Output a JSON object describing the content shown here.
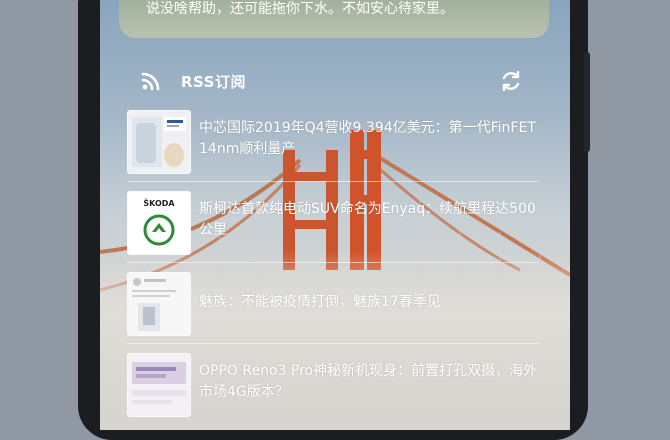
{
  "top_card": {
    "text": "说没啥帮助，还可能拖你下水。不如安心待家里。"
  },
  "rss": {
    "title": "RSS订阅",
    "icon": "rss-icon",
    "refresh_icon": "refresh-icon"
  },
  "feed": [
    {
      "title": "中芯国际2019年Q4营收9.394亿美元：第一代FinFET 14nm顺利量产"
    },
    {
      "title": "斯柯达首款纯电动SUV命名为Enyaq：续航里程达500公里",
      "thumb_logo": "ŠKODA"
    },
    {
      "title": "魅族：不能被疫情打倒，魅族17春季见"
    },
    {
      "title": "OPPO Reno3 Pro神秘新机现身：前置打孔双摄，海外市场4G版本？"
    }
  ],
  "colors": {
    "text": "#ffffff",
    "bridge": "#c9562f",
    "skoda_green": "#2f8a3a"
  }
}
